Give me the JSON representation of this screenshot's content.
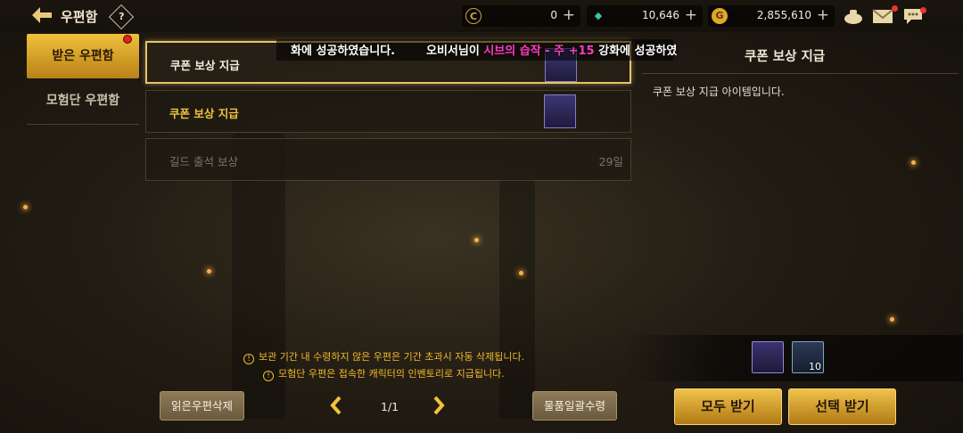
{
  "header": {
    "title": "우편함",
    "help_glyph": "?",
    "currencies": [
      {
        "icon": "c-coin-icon",
        "symbol": "C",
        "value": "0",
        "color": "#c9a34a"
      },
      {
        "icon": "gem-icon",
        "symbol": "◆",
        "value": "10,646",
        "color": "#3fc0b0"
      },
      {
        "icon": "gold-coin-icon",
        "symbol": "G",
        "value": "2,855,610",
        "color": "#e0a62a"
      }
    ],
    "plus": "+"
  },
  "tabs": [
    {
      "label": "받은 우편함",
      "active": true
    },
    {
      "label": "모험단 우편함",
      "active": false
    }
  ],
  "notice": {
    "left": "화에 성공하였습니다.",
    "right_prefix": "오비서님이 ",
    "right_highlight": "시브의 습작 - 주 +15",
    "right_suffix": " 강화에 성공하였"
  },
  "mails": [
    {
      "name": "쿠폰 보상 지급",
      "style": "white",
      "selected": true,
      "days": ""
    },
    {
      "name": "쿠폰 보상 지급",
      "style": "gold",
      "selected": false,
      "days": ""
    },
    {
      "name": "길드 출석 보상",
      "style": "dim",
      "selected": false,
      "days": "29일"
    }
  ],
  "detail": {
    "title": "쿠폰 보상 지급",
    "body": "쿠폰 보상 지급 아이템입니다."
  },
  "rewards": [
    {
      "icon": "potion-jar-icon",
      "qty": ""
    },
    {
      "icon": "treasure-chest-icon",
      "qty": "10"
    }
  ],
  "warnings": [
    "보관 기간 내 수령하지 않은 우편은 기간 초과시 자동 삭제됩니다.",
    "모험단 우편은 접속한 캐릭터의 인벤토리로 지급됩니다."
  ],
  "footer": {
    "delete_read": "읽은우편삭제",
    "page": "1/1",
    "claim_items": "물품일괄수령",
    "receive_all": "모두 받기",
    "receive_selected": "선택 받기"
  }
}
